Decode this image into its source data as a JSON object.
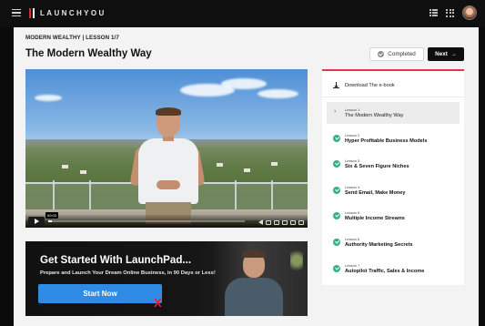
{
  "topbar": {
    "brand": "LAUNCHYOU",
    "icons": [
      "menu-icon",
      "list-view-icon",
      "grid-view-icon",
      "user-avatar"
    ]
  },
  "breadcrumb": "MODERN WEALTHY | LESSON 1/7",
  "page_title": "The Modern Wealthy Way",
  "actions": {
    "completed_label": "Completed",
    "next_label": "Next"
  },
  "video": {
    "time_tooltip": "00:03",
    "progress": 0.02
  },
  "banner": {
    "title": "Get Started With LaunchPad...",
    "subtitle": "Prepare and Launch Your Dream Online Business, in 90 Days or Less!",
    "cta": "Start Now",
    "mark": "X"
  },
  "sidebar": {
    "download_label": "Download The e-book",
    "lessons": [
      {
        "num": "Lesson 1",
        "name": "The Modern Wealthy Way",
        "active": true
      },
      {
        "num": "Lesson 2",
        "name": "Hyper Profitable Business Models"
      },
      {
        "num": "Lesson 3",
        "name": "Six & Seven Figure Niches"
      },
      {
        "num": "Lesson 4",
        "name": "Send Email, Make Money"
      },
      {
        "num": "Lesson 5",
        "name": "Multiple Income Streams"
      },
      {
        "num": "Lesson 6",
        "name": "Authority Marketing Secrets"
      },
      {
        "num": "Lesson 7",
        "name": "Autopilot Traffic, Sales & Income"
      }
    ]
  },
  "colors": {
    "accent": "#e0374d",
    "check": "#37b08a",
    "cta": "#2f8be6",
    "mark": "#e8202a"
  }
}
